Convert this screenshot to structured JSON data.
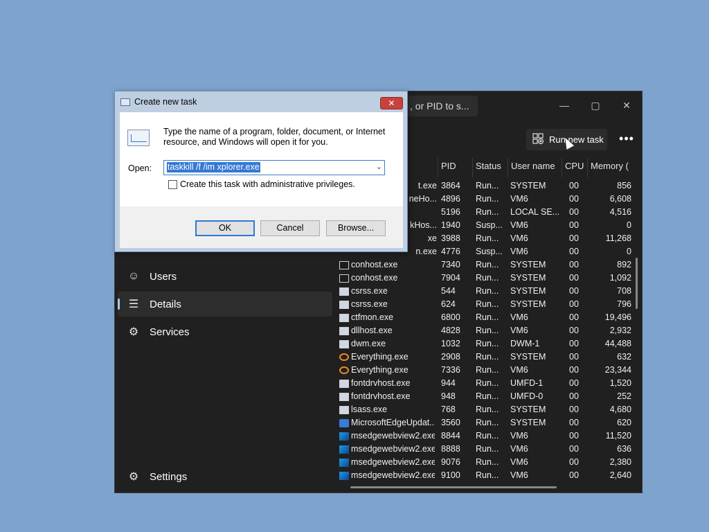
{
  "taskmgr": {
    "search_placeholder": ", or PID to s...",
    "window_controls": {
      "minimize": "—",
      "maximize": "▢",
      "close": "✕"
    },
    "run_new_task": "Run new task",
    "more": "•••",
    "sidebar": {
      "items": [
        {
          "label": "Users",
          "icon": "users-icon",
          "glyph": "☺"
        },
        {
          "label": "Details",
          "icon": "list-icon",
          "glyph": "☰"
        },
        {
          "label": "Services",
          "icon": "puzzle-icon",
          "glyph": "⚙"
        }
      ],
      "settings": {
        "label": "Settings",
        "icon": "gear-icon",
        "glyph": "⚙"
      }
    },
    "columns": [
      "PID",
      "Status",
      "User name",
      "CPU",
      "Memory ("
    ],
    "rows": [
      {
        "name": "t.exe",
        "pid": "3864",
        "status": "Run...",
        "user": "SYSTEM",
        "cpu": "00",
        "mem": "856"
      },
      {
        "name": "neHo...",
        "pid": "4896",
        "status": "Run...",
        "user": "VM6",
        "cpu": "00",
        "mem": "6,608"
      },
      {
        "name": "",
        "pid": "5196",
        "status": "Run...",
        "user": "LOCAL SE...",
        "cpu": "00",
        "mem": "4,516"
      },
      {
        "name": "kHos...",
        "pid": "1940",
        "status": "Susp...",
        "user": "VM6",
        "cpu": "00",
        "mem": "0"
      },
      {
        "name": "xe",
        "pid": "3988",
        "status": "Run...",
        "user": "VM6",
        "cpu": "00",
        "mem": "11,268"
      },
      {
        "name": "n.exe",
        "pid": "4776",
        "status": "Susp...",
        "user": "VM6",
        "cpu": "00",
        "mem": "0"
      },
      {
        "name": "conhost.exe",
        "pid": "7340",
        "status": "Run...",
        "user": "SYSTEM",
        "cpu": "00",
        "mem": "892",
        "icon": "console"
      },
      {
        "name": "conhost.exe",
        "pid": "7904",
        "status": "Run...",
        "user": "SYSTEM",
        "cpu": "00",
        "mem": "1,092",
        "icon": "console"
      },
      {
        "name": "csrss.exe",
        "pid": "544",
        "status": "Run...",
        "user": "SYSTEM",
        "cpu": "00",
        "mem": "708",
        "icon": "window"
      },
      {
        "name": "csrss.exe",
        "pid": "624",
        "status": "Run...",
        "user": "SYSTEM",
        "cpu": "00",
        "mem": "796",
        "icon": "window"
      },
      {
        "name": "ctfmon.exe",
        "pid": "6800",
        "status": "Run...",
        "user": "VM6",
        "cpu": "00",
        "mem": "19,496",
        "icon": "window"
      },
      {
        "name": "dllhost.exe",
        "pid": "4828",
        "status": "Run...",
        "user": "VM6",
        "cpu": "00",
        "mem": "2,932",
        "icon": "window"
      },
      {
        "name": "dwm.exe",
        "pid": "1032",
        "status": "Run...",
        "user": "DWM-1",
        "cpu": "00",
        "mem": "44,488",
        "icon": "window"
      },
      {
        "name": "Everything.exe",
        "pid": "2908",
        "status": "Run...",
        "user": "SYSTEM",
        "cpu": "00",
        "mem": "632",
        "icon": "search"
      },
      {
        "name": "Everything.exe",
        "pid": "7336",
        "status": "Run...",
        "user": "VM6",
        "cpu": "00",
        "mem": "23,344",
        "icon": "search"
      },
      {
        "name": "fontdrvhost.exe",
        "pid": "944",
        "status": "Run...",
        "user": "UMFD-1",
        "cpu": "00",
        "mem": "1,520",
        "icon": "window"
      },
      {
        "name": "fontdrvhost.exe",
        "pid": "948",
        "status": "Run...",
        "user": "UMFD-0",
        "cpu": "00",
        "mem": "252",
        "icon": "window"
      },
      {
        "name": "lsass.exe",
        "pid": "768",
        "status": "Run...",
        "user": "SYSTEM",
        "cpu": "00",
        "mem": "4,680",
        "icon": "window"
      },
      {
        "name": "MicrosoftEdgeUpdat...",
        "pid": "3560",
        "status": "Run...",
        "user": "SYSTEM",
        "cpu": "00",
        "mem": "620",
        "icon": "edge-up"
      },
      {
        "name": "msedgewebview2.exe",
        "pid": "8844",
        "status": "Run...",
        "user": "VM6",
        "cpu": "00",
        "mem": "11,520",
        "icon": "webview"
      },
      {
        "name": "msedgewebview2.exe",
        "pid": "8888",
        "status": "Run...",
        "user": "VM6",
        "cpu": "00",
        "mem": "636",
        "icon": "webview"
      },
      {
        "name": "msedgewebview2.exe",
        "pid": "9076",
        "status": "Run...",
        "user": "VM6",
        "cpu": "00",
        "mem": "2,380",
        "icon": "webview"
      },
      {
        "name": "msedgewebview2.exe",
        "pid": "9100",
        "status": "Run...",
        "user": "VM6",
        "cpu": "00",
        "mem": "2,640",
        "icon": "webview"
      }
    ]
  },
  "dialog": {
    "title": "Create new task",
    "close": "✕",
    "prompt": "Type the name of a program, folder, document, or Internet resource, and Windows will open it for you.",
    "open_label": "Open:",
    "open_value": "taskkill /f /im xplorer.exe",
    "combo_arrow": "⌄",
    "admin_label": "Create this task with administrative privileges.",
    "ok": "OK",
    "cancel": "Cancel",
    "browse": "Browse..."
  }
}
